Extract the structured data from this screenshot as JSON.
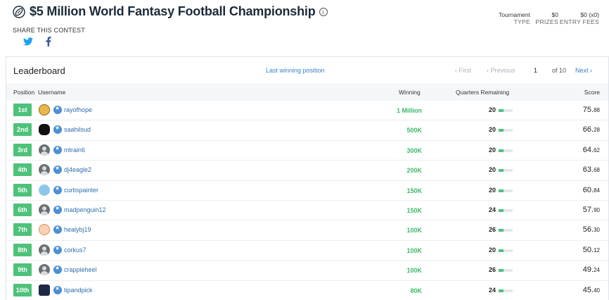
{
  "header": {
    "title": "$5 Million World Fantasy Football Championship",
    "info_icon": "info-icon",
    "share_label": "SHARE THIS CONTEST",
    "share": [
      {
        "icon": "twitter-icon",
        "color": "#1da1f2"
      },
      {
        "icon": "facebook-icon",
        "color": "#3b5998"
      }
    ],
    "meta": {
      "type_value": "Tournament",
      "type_label": "TYPE",
      "prizes_value": "$0",
      "prizes_label": "PRIZES",
      "fees_value": "$0 (x0)",
      "fees_label": "ENTRY FEES"
    }
  },
  "leaderboard": {
    "title": "Leaderboard",
    "last_winning_link": "Last winning position",
    "pager": {
      "first": "‹ First",
      "prev": "‹ Previous",
      "page": "1",
      "of": "of 10",
      "next": "Next ›"
    },
    "columns": {
      "position": "Position",
      "username": "Username",
      "winning": "Winning",
      "quarters": "Quarters Remaining",
      "score": "Score"
    },
    "rows": [
      {
        "rank": "1st",
        "user": "rayofhope",
        "avatar": "av-yellow",
        "winning": "1 Million",
        "quarters": "20",
        "q_fraction": 0.35,
        "score_int": "75.",
        "score_dec": "88"
      },
      {
        "rank": "2nd",
        "user": "saahilsud",
        "avatar": "av-black",
        "winning": "500K",
        "quarters": "20",
        "q_fraction": 0.35,
        "score_int": "66.",
        "score_dec": "28"
      },
      {
        "rank": "3rd",
        "user": "mtrain6",
        "avatar": "av-default",
        "winning": "300K",
        "quarters": "20",
        "q_fraction": 0.35,
        "score_int": "64.",
        "score_dec": "62"
      },
      {
        "rank": "4th",
        "user": "dj4eagle2",
        "avatar": "av-default",
        "winning": "200K",
        "quarters": "20",
        "q_fraction": 0.35,
        "score_int": "63.",
        "score_dec": "68"
      },
      {
        "rank": "5th",
        "user": "curtispainter",
        "avatar": "av-blue",
        "winning": "150K",
        "quarters": "20",
        "q_fraction": 0.35,
        "score_int": "60.",
        "score_dec": "84"
      },
      {
        "rank": "6th",
        "user": "madpenguin12",
        "avatar": "av-default",
        "winning": "150K",
        "quarters": "24",
        "q_fraction": 0.35,
        "score_int": "57.",
        "score_dec": "90"
      },
      {
        "rank": "7th",
        "user": "healybj19",
        "avatar": "av-orange",
        "winning": "100K",
        "quarters": "26",
        "q_fraction": 0.35,
        "score_int": "56.",
        "score_dec": "30"
      },
      {
        "rank": "8th",
        "user": "corkus7",
        "avatar": "av-default",
        "winning": "100K",
        "quarters": "20",
        "q_fraction": 0.35,
        "score_int": "50.",
        "score_dec": "12"
      },
      {
        "rank": "9th",
        "user": "crappieheel",
        "avatar": "av-default",
        "winning": "100K",
        "quarters": "26",
        "q_fraction": 0.35,
        "score_int": "49.",
        "score_dec": "24"
      },
      {
        "rank": "10th",
        "user": "tipandpick",
        "avatar": "av-navy",
        "winning": "80K",
        "quarters": "24",
        "q_fraction": 0.35,
        "score_int": "45.",
        "score_dec": "40"
      }
    ]
  },
  "colors": {
    "accent_green": "#4ec27a",
    "link_blue": "#3a82c9",
    "title_navy": "#1c2b39"
  }
}
